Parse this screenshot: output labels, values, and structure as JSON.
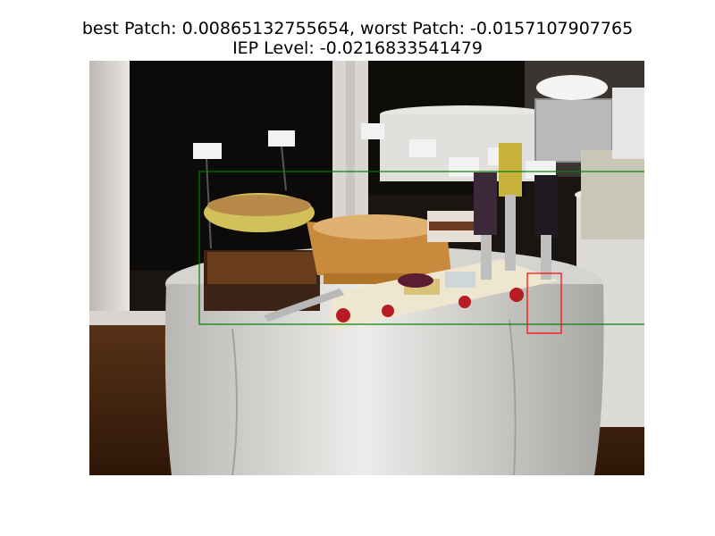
{
  "figure": {
    "title_line_1": "best Patch: 0.00865132755654, worst Patch: -0.0157107907765",
    "title_line_2": "IEP Level: -0.0216833541479"
  },
  "overlays": {
    "best_patch_color": "#008000",
    "worst_patch_color": "#ff0000"
  }
}
